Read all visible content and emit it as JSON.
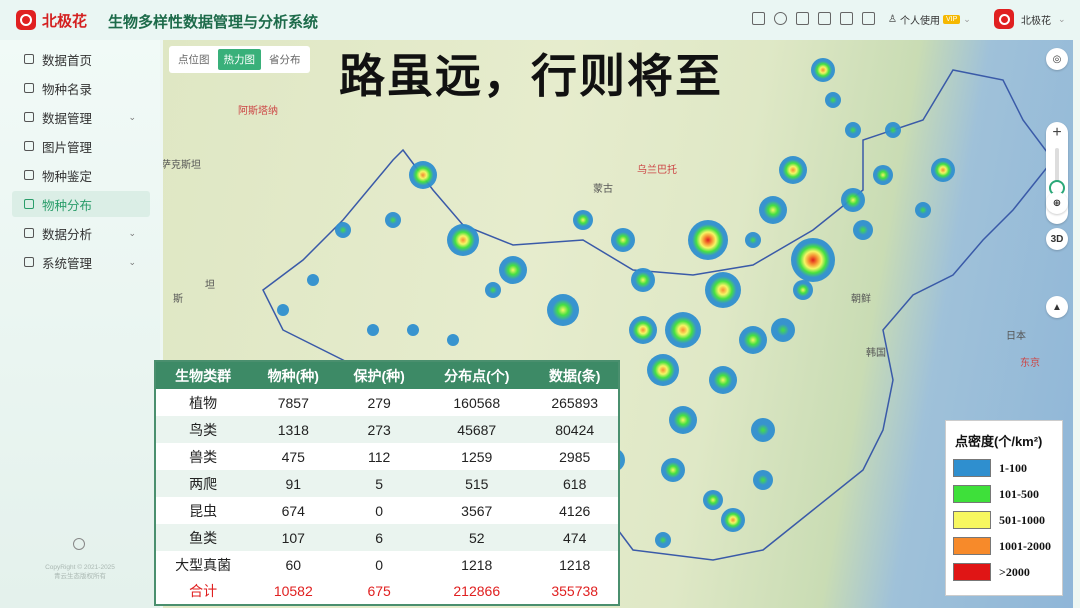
{
  "header": {
    "brand": "北极花",
    "title": "生物多样性数据管理与分析系统",
    "user_mode": "个人使用",
    "vip": "VIP",
    "account": "北极花"
  },
  "sidebar": {
    "items": [
      {
        "label": "数据首页",
        "icon": "dashboard-icon"
      },
      {
        "label": "物种名录",
        "icon": "book-icon"
      },
      {
        "label": "数据管理",
        "icon": "database-icon",
        "expandable": true
      },
      {
        "label": "图片管理",
        "icon": "image-icon"
      },
      {
        "label": "物种鉴定",
        "icon": "identify-icon"
      },
      {
        "label": "物种分布",
        "icon": "map-icon",
        "active": true
      },
      {
        "label": "数据分析",
        "icon": "chart-icon",
        "expandable": true
      },
      {
        "label": "系统管理",
        "icon": "gear-icon",
        "expandable": true
      }
    ],
    "copyright": "CopyRight © 2021-2025",
    "copyright2": "青云生态版权所有"
  },
  "map": {
    "tabs": [
      "点位图",
      "热力图",
      "省分布"
    ],
    "active_tab": "热力图",
    "slogan": "路虽远，行则将至",
    "labels": {
      "astana": "阿斯塔纳",
      "kazakhstan": "萨克斯坦",
      "ulaanbaatar": "乌兰巴托",
      "mongolia": "蒙古",
      "si": "斯",
      "tan": "坦",
      "nk": "朝鲜",
      "sk": "韩国",
      "japan": "日本",
      "tokyo": "东京"
    },
    "controls": {
      "3d": "3D"
    }
  },
  "legend": {
    "title": "点密度(个/km²)",
    "items": [
      {
        "label": "1-100",
        "color": "#2f8fcf"
      },
      {
        "label": "101-500",
        "color": "#3ee03a"
      },
      {
        "label": "501-1000",
        "color": "#f7f760"
      },
      {
        "label": "1001-2000",
        "color": "#f78a2a"
      },
      {
        "label": ">2000",
        "color": "#e01515"
      }
    ]
  },
  "table": {
    "headers": [
      "生物类群",
      "物种(种)",
      "保护(种)",
      "分布点(个)",
      "数据(条)"
    ],
    "rows": [
      [
        "植物",
        "7857",
        "279",
        "160568",
        "265893"
      ],
      [
        "鸟类",
        "1318",
        "273",
        "45687",
        "80424"
      ],
      [
        "兽类",
        "475",
        "112",
        "1259",
        "2985"
      ],
      [
        "两爬",
        "91",
        "5",
        "515",
        "618"
      ],
      [
        "昆虫",
        "674",
        "0",
        "3567",
        "4126"
      ],
      [
        "鱼类",
        "107",
        "6",
        "52",
        "474"
      ],
      [
        "大型真菌",
        "60",
        "0",
        "1218",
        "1218"
      ]
    ],
    "total": [
      "合计",
      "10582",
      "675",
      "212866",
      "355738"
    ]
  }
}
